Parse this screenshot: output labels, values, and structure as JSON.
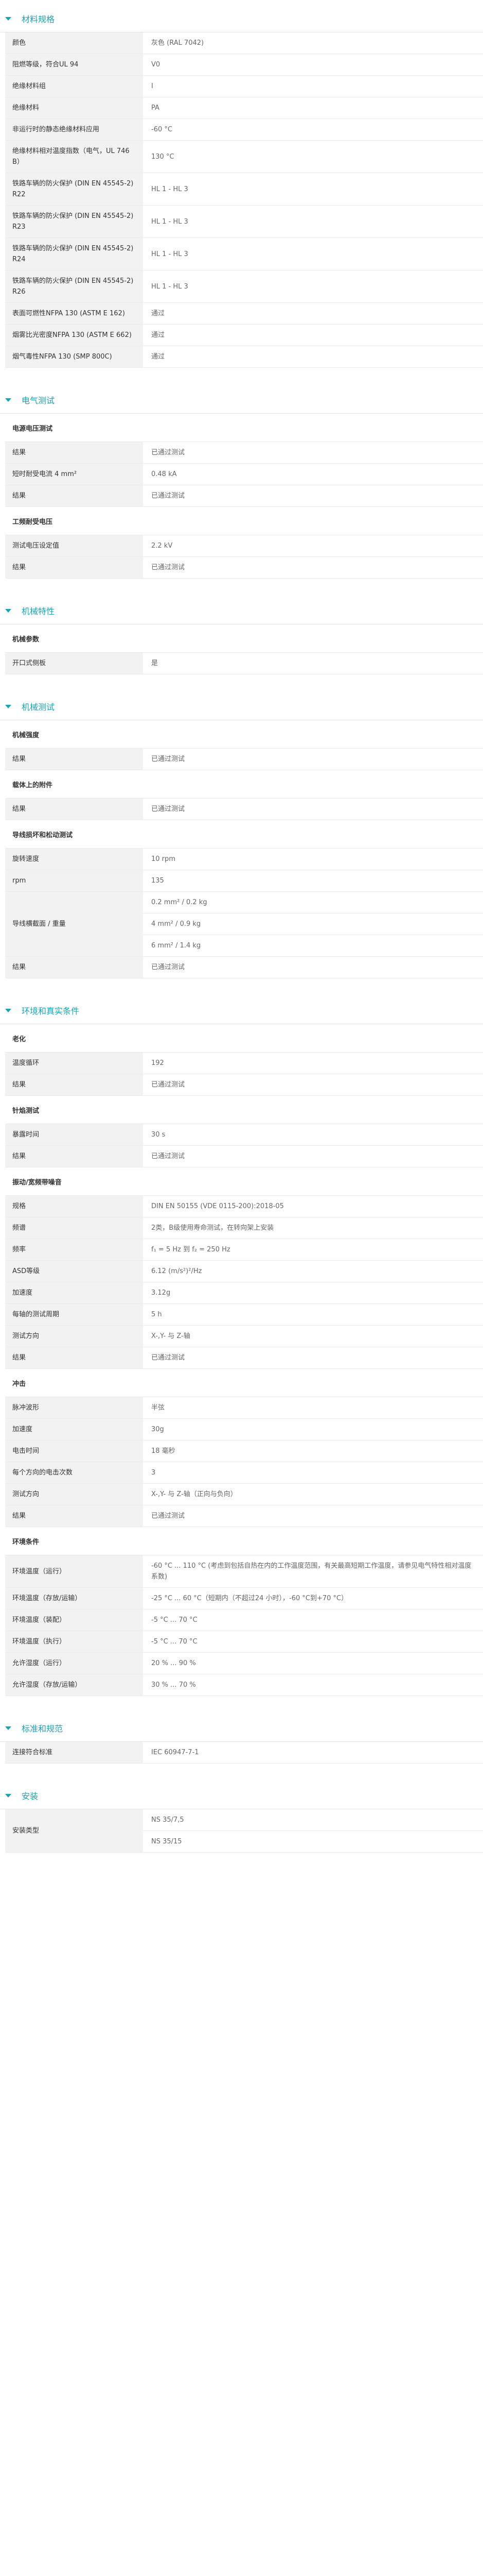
{
  "sections": [
    {
      "title": "材料规格",
      "rows": [
        {
          "type": "row",
          "label": "颜色",
          "values": [
            "灰色 (RAL 7042)"
          ]
        },
        {
          "type": "row",
          "label": "阻燃等级，符合UL 94",
          "values": [
            "V0"
          ]
        },
        {
          "type": "row",
          "label": "绝缘材料组",
          "values": [
            "I"
          ]
        },
        {
          "type": "row",
          "label": "绝缘材料",
          "values": [
            "PA"
          ]
        },
        {
          "type": "row",
          "label": "非运行时的静态绝缘材料应用",
          "values": [
            "-60 °C"
          ]
        },
        {
          "type": "row",
          "label": "绝缘材料相对温度指数（电气，UL 746 B）",
          "values": [
            "130 °C"
          ]
        },
        {
          "type": "row",
          "label": "铁路车辆的防火保护 (DIN EN 45545-2) R22",
          "values": [
            "HL 1 - HL 3"
          ]
        },
        {
          "type": "row",
          "label": "铁路车辆的防火保护 (DIN EN 45545-2) R23",
          "values": [
            "HL 1 - HL 3"
          ]
        },
        {
          "type": "row",
          "label": "铁路车辆的防火保护 (DIN EN 45545-2) R24",
          "values": [
            "HL 1 - HL 3"
          ]
        },
        {
          "type": "row",
          "label": "铁路车辆的防火保护 (DIN EN 45545-2) R26",
          "values": [
            "HL 1 - HL 3"
          ]
        },
        {
          "type": "row",
          "label": "表面可燃性NFPA 130 (ASTM E 162)",
          "values": [
            "通过"
          ]
        },
        {
          "type": "row",
          "label": "烟雾比光密度NFPA 130 (ASTM E 662)",
          "values": [
            "通过"
          ]
        },
        {
          "type": "row",
          "label": "烟气毒性NFPA 130 (SMP 800C)",
          "values": [
            "通过"
          ]
        }
      ]
    },
    {
      "title": "电气测试",
      "rows": [
        {
          "type": "subhead",
          "label": "电源电压测试"
        },
        {
          "type": "row",
          "label": "结果",
          "values": [
            "已通过测试"
          ]
        },
        {
          "type": "row",
          "label": "短时耐受电流 4 mm²",
          "values": [
            "0.48 kA"
          ]
        },
        {
          "type": "row",
          "label": "结果",
          "values": [
            "已通过测试"
          ]
        },
        {
          "type": "subhead",
          "label": "工频耐受电压"
        },
        {
          "type": "row",
          "label": "测试电压设定值",
          "values": [
            "2.2 kV"
          ]
        },
        {
          "type": "row",
          "label": "结果",
          "values": [
            "已通过测试"
          ]
        }
      ]
    },
    {
      "title": "机械特性",
      "rows": [
        {
          "type": "subhead",
          "label": "机械参数"
        },
        {
          "type": "row",
          "label": "开口式侧板",
          "values": [
            "是"
          ]
        }
      ]
    },
    {
      "title": "机械测试",
      "rows": [
        {
          "type": "subhead",
          "label": "机械强度"
        },
        {
          "type": "row",
          "label": "结果",
          "values": [
            "已通过测试"
          ]
        },
        {
          "type": "subhead",
          "label": "载体上的附件"
        },
        {
          "type": "row",
          "label": "结果",
          "values": [
            "已通过测试"
          ]
        },
        {
          "type": "subhead",
          "label": "导线损坏和松动测试"
        },
        {
          "type": "row",
          "label": "旋转速度",
          "values": [
            "10 rpm"
          ]
        },
        {
          "type": "row",
          "label": "rpm",
          "values": [
            "135"
          ]
        },
        {
          "type": "multi",
          "label": "导线横截面 / 重量",
          "values": [
            "0.2 mm² / 0.2 kg",
            "4 mm² / 0.9 kg",
            "6 mm² / 1.4 kg"
          ]
        },
        {
          "type": "row",
          "label": "结果",
          "values": [
            "已通过测试"
          ]
        }
      ]
    },
    {
      "title": "环境和真实条件",
      "rows": [
        {
          "type": "subhead",
          "label": "老化"
        },
        {
          "type": "row",
          "label": "温度循环",
          "values": [
            "192"
          ]
        },
        {
          "type": "row",
          "label": "结果",
          "values": [
            "已通过测试"
          ]
        },
        {
          "type": "subhead",
          "label": "针焰测试"
        },
        {
          "type": "row",
          "label": "暴露时间",
          "values": [
            "30 s"
          ]
        },
        {
          "type": "row",
          "label": "结果",
          "values": [
            "已通过测试"
          ]
        },
        {
          "type": "subhead",
          "label": "振动/宽频带噪音"
        },
        {
          "type": "row",
          "label": "规格",
          "values": [
            "DIN EN 50155 (VDE 0115-200):2018-05"
          ]
        },
        {
          "type": "row",
          "label": "频谱",
          "values": [
            "2类，B级使用寿命测试，在转向架上安装"
          ]
        },
        {
          "type": "row",
          "label": "频率",
          "values": [
            "f₁ = 5 Hz 到 f₂ = 250 Hz"
          ]
        },
        {
          "type": "row",
          "label": "ASD等级",
          "values": [
            "6.12 (m/s²)²/Hz"
          ]
        },
        {
          "type": "row",
          "label": "加速度",
          "values": [
            "3.12g"
          ]
        },
        {
          "type": "row",
          "label": "每轴的测试周期",
          "values": [
            "5 h"
          ]
        },
        {
          "type": "row",
          "label": "测试方向",
          "values": [
            "X-,Y- 与 Z-轴"
          ]
        },
        {
          "type": "row",
          "label": "结果",
          "values": [
            "已通过测试"
          ]
        },
        {
          "type": "subhead",
          "label": "冲击"
        },
        {
          "type": "row",
          "label": "脉冲波形",
          "values": [
            "半弦"
          ]
        },
        {
          "type": "row",
          "label": "加速度",
          "values": [
            "30g"
          ]
        },
        {
          "type": "row",
          "label": "电击时间",
          "values": [
            "18 毫秒"
          ]
        },
        {
          "type": "row",
          "label": "每个方向的电击次数",
          "values": [
            "3"
          ]
        },
        {
          "type": "row",
          "label": "测试方向",
          "values": [
            "X-,Y- 与 Z-轴（正向与负向）"
          ]
        },
        {
          "type": "row",
          "label": "结果",
          "values": [
            "已通过测试"
          ]
        },
        {
          "type": "subhead",
          "label": "环境条件"
        },
        {
          "type": "row",
          "label": "环境温度（运行）",
          "values": [
            "-60 °C ... 110 °C (考虑到包括自热在内的工作温度范围，有关最高短期工作温度，请参见电气特性相对温度系数)"
          ]
        },
        {
          "type": "row",
          "label": "环境温度（存放/运输）",
          "values": [
            "-25 °C ... 60 °C（短期内（不超过24 小时），-60 °C到+70 °C）"
          ]
        },
        {
          "type": "row",
          "label": "环境温度（装配）",
          "values": [
            "-5 °C ... 70 °C"
          ]
        },
        {
          "type": "row",
          "label": "环境温度（执行）",
          "values": [
            "-5 °C ... 70 °C"
          ]
        },
        {
          "type": "row",
          "label": "允许湿度（运行）",
          "values": [
            "20 % ... 90 %"
          ]
        },
        {
          "type": "row",
          "label": "允许湿度（存放/运输）",
          "values": [
            "30 % ... 70 %"
          ]
        }
      ]
    },
    {
      "title": "标准和规范",
      "rows": [
        {
          "type": "row",
          "label": "连接符合标准",
          "values": [
            "IEC 60947-7-1"
          ]
        }
      ]
    },
    {
      "title": "安装",
      "rows": [
        {
          "type": "multi",
          "label": "安装类型",
          "values": [
            "NS 35/7,5",
            "NS 35/15"
          ]
        }
      ]
    }
  ]
}
